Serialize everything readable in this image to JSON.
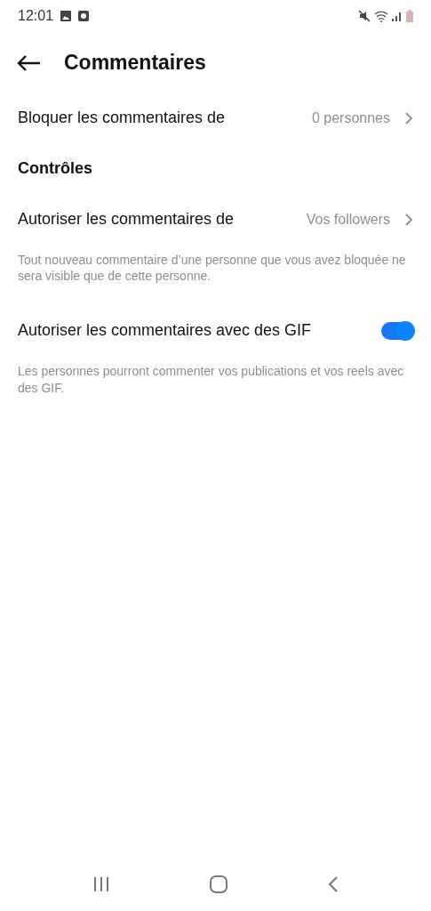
{
  "status_bar": {
    "time": "12:01"
  },
  "header": {
    "title": "Commentaires"
  },
  "items": [
    {
      "kind": "link",
      "label": "Bloquer les commentaires de",
      "value": "0 personnes"
    },
    {
      "kind": "section",
      "label": "Contrôles"
    },
    {
      "kind": "link",
      "label": "Autoriser les commentaires de",
      "value": "Vos followers"
    },
    {
      "kind": "note",
      "label": "Tout nouveau commentaire d’une personne que vous avez bloquée ne sera visible que de cette personne."
    },
    {
      "kind": "toggle",
      "label": "Autoriser les commentaires avec des GIF",
      "on": true
    },
    {
      "kind": "note",
      "label": "Les personnes pourront commenter vos publications et vos reels avec des GIF."
    }
  ]
}
